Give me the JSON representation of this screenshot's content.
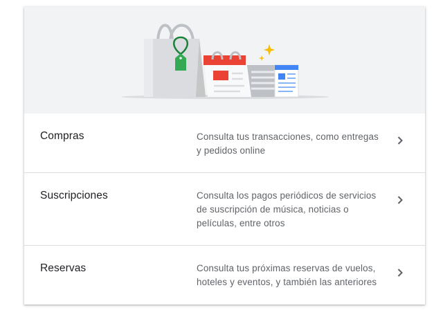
{
  "rows": [
    {
      "title": "Compras",
      "description": "Consulta tus transacciones, como entregas y pedidos online",
      "icon": "chevron-right-icon"
    },
    {
      "title": "Suscripciones",
      "description": "Consulta los pagos periódicos de servicios de suscripción de música, noticias o películas, entre otros",
      "icon": "chevron-right-icon"
    },
    {
      "title": "Reservas",
      "description": "Consulta tus próximas reservas de vuelos, hoteles y eventos, y también las anteriores",
      "icon": "chevron-right-icon"
    }
  ],
  "hero": {
    "illustration": [
      "shopping-bag-icon",
      "price-tag-icon",
      "calendar-icon",
      "newspaper-icon",
      "sparkle-icon"
    ]
  },
  "colors": {
    "hero_background": "#f1f3f4",
    "divider": "#dadce0",
    "title_text": "#202124",
    "description_text": "#5f6368",
    "tag_green": "#34a853",
    "calendar_red": "#ea4335",
    "news_blue": "#4285f4",
    "sparkle_yellow": "#fbbc04"
  }
}
